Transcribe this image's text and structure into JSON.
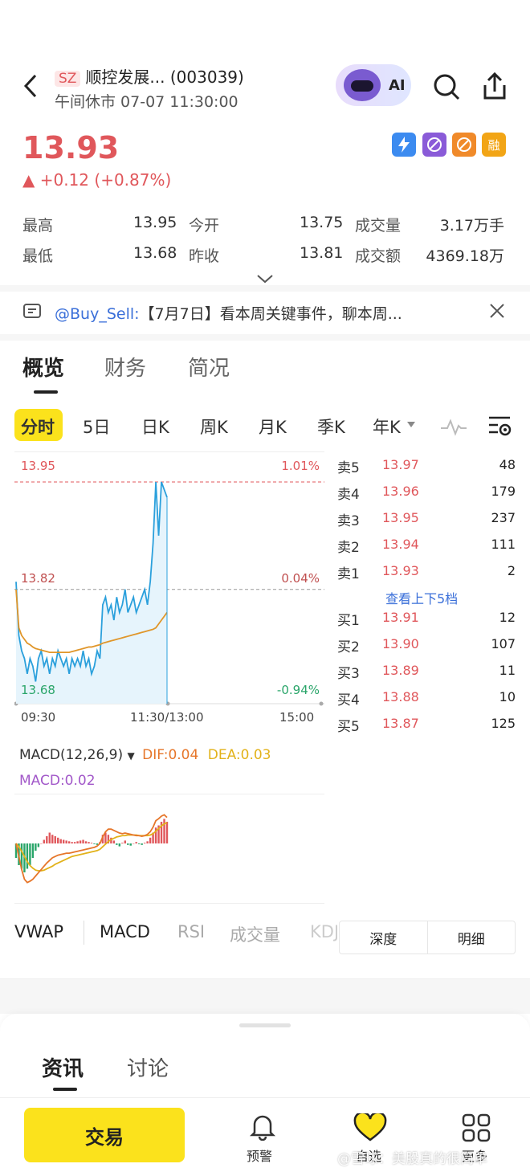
{
  "header": {
    "exchange": "SZ",
    "title": "顺控发展... (003039)",
    "status": "午间休市 07-07 11:30:00",
    "ai_label": "AI"
  },
  "quote": {
    "price": "13.93",
    "change": "▲ +0.12 (+0.87%)",
    "badges": [
      "1",
      "",
      "",
      "融"
    ],
    "stats": [
      {
        "l1": "最高",
        "v1": "13.95",
        "l2": "今开",
        "v2": "13.75",
        "l3": "成交量",
        "v3": "3.17万手"
      },
      {
        "l1": "最低",
        "v1": "13.68",
        "l2": "昨收",
        "v2": "13.81",
        "l3": "成交额",
        "v3": "4369.18万"
      }
    ]
  },
  "notice": {
    "user": "@Buy_Sell:",
    "text": "【7月7日】看本周关键事件，聊本周..."
  },
  "main_tabs": [
    "概览",
    "财务",
    "简况"
  ],
  "period_tabs": [
    "分时",
    "5日",
    "日K",
    "周K",
    "月K",
    "季K",
    "年K"
  ],
  "chart": {
    "price_high": "13.95",
    "price_mid": "13.82",
    "price_low": "13.68",
    "pct_high": "1.01%",
    "pct_mid": "0.04%",
    "pct_low": "-0.94%",
    "time_start": "09:30",
    "time_mid": "11:30/13:00",
    "time_end": "15:00",
    "price_series": [
      13.82,
      13.75,
      13.73,
      13.72,
      13.7,
      13.72,
      13.71,
      13.69,
      13.72,
      13.73,
      13.71,
      13.72,
      13.7,
      13.72,
      13.71,
      13.73,
      13.72,
      13.71,
      13.72,
      13.7,
      13.72,
      13.71,
      13.72,
      13.71,
      13.73,
      13.71,
      13.72,
      13.7,
      13.71,
      13.73,
      13.72,
      13.79,
      13.8,
      13.78,
      13.79,
      13.77,
      13.8,
      13.78,
      13.79,
      13.81,
      13.78,
      13.79,
      13.8,
      13.78,
      13.79,
      13.8,
      13.81,
      13.79,
      13.82,
      13.87,
      13.95,
      13.88,
      13.95,
      13.94,
      13.93
    ],
    "avg_series": [
      13.81,
      13.76,
      13.75,
      13.745,
      13.74,
      13.738,
      13.735,
      13.733,
      13.732,
      13.731,
      13.73,
      13.729,
      13.728,
      13.728,
      13.728,
      13.728,
      13.728,
      13.728,
      13.728,
      13.728,
      13.729,
      13.73,
      13.731,
      13.732,
      13.733,
      13.734,
      13.735,
      13.735,
      13.736,
      13.737,
      13.738,
      13.74,
      13.741,
      13.742,
      13.743,
      13.744,
      13.745,
      13.746,
      13.747,
      13.748,
      13.749,
      13.75,
      13.751,
      13.752,
      13.753,
      13.754,
      13.755,
      13.756,
      13.757,
      13.758,
      13.76,
      13.765,
      13.77,
      13.775,
      13.78
    ]
  },
  "orderbook": {
    "sells": [
      {
        "label": "卖5",
        "price": "13.97",
        "vol": "48"
      },
      {
        "label": "卖4",
        "price": "13.96",
        "vol": "179"
      },
      {
        "label": "卖3",
        "price": "13.95",
        "vol": "237"
      },
      {
        "label": "卖2",
        "price": "13.94",
        "vol": "111"
      },
      {
        "label": "卖1",
        "price": "13.93",
        "vol": "2"
      }
    ],
    "more": "查看上下5档",
    "buys": [
      {
        "label": "买1",
        "price": "13.91",
        "vol": "12"
      },
      {
        "label": "买2",
        "price": "13.90",
        "vol": "107"
      },
      {
        "label": "买3",
        "price": "13.89",
        "vol": "11"
      },
      {
        "label": "买4",
        "price": "13.88",
        "vol": "10"
      },
      {
        "label": "买5",
        "price": "13.87",
        "vol": "125"
      }
    ]
  },
  "macd": {
    "title": "MACD(12,26,9)",
    "dif": "DIF:0.04",
    "dea": "DEA:0.03",
    "macd": "MACD:0.02",
    "bars": [
      -0.02,
      -0.03,
      -0.035,
      -0.04,
      -0.035,
      -0.03,
      -0.02,
      -0.01,
      -0.005,
      0,
      0.005,
      0.01,
      0.015,
      0.012,
      0.01,
      0.008,
      0.006,
      0.005,
      0.004,
      0.003,
      0.002,
      0.002,
      0.003,
      0.004,
      0.005,
      0.003,
      0.002,
      0.001,
      -0.001,
      -0.002,
      0.002,
      0.012,
      0.015,
      0.012,
      0.008,
      0.004,
      -0.002,
      -0.004,
      0.001,
      0.004,
      -0.002,
      -0.003,
      0,
      0.002,
      -0.001,
      -0.002,
      0.001,
      0.003,
      0.008,
      0.015,
      0.022,
      0.025,
      0.03,
      0.034,
      0.03
    ],
    "dif_series": [
      0,
      -0.02,
      -0.04,
      -0.055,
      -0.06,
      -0.058,
      -0.055,
      -0.05,
      -0.045,
      -0.04,
      -0.035,
      -0.03,
      -0.026,
      -0.022,
      -0.02,
      -0.018,
      -0.017,
      -0.016,
      -0.015,
      -0.015,
      -0.014,
      -0.013,
      -0.012,
      -0.011,
      -0.01,
      -0.009,
      -0.008,
      -0.007,
      -0.006,
      -0.004,
      0.0,
      0.01,
      0.018,
      0.022,
      0.022,
      0.02,
      0.018,
      0.016,
      0.015,
      0.016,
      0.015,
      0.014,
      0.013,
      0.012,
      0.012,
      0.011,
      0.012,
      0.014,
      0.018,
      0.025,
      0.035,
      0.038,
      0.042,
      0.044,
      0.04
    ],
    "dea_series": [
      0,
      -0.005,
      -0.012,
      -0.02,
      -0.028,
      -0.034,
      -0.038,
      -0.041,
      -0.042,
      -0.042,
      -0.041,
      -0.039,
      -0.037,
      -0.035,
      -0.032,
      -0.03,
      -0.028,
      -0.026,
      -0.024,
      -0.022,
      -0.02,
      -0.019,
      -0.018,
      -0.017,
      -0.016,
      -0.015,
      -0.014,
      -0.013,
      -0.012,
      -0.011,
      -0.009,
      -0.005,
      -0.001,
      0.003,
      0.006,
      0.008,
      0.01,
      0.011,
      0.012,
      0.012,
      0.013,
      0.013,
      0.013,
      0.013,
      0.012,
      0.012,
      0.012,
      0.012,
      0.013,
      0.015,
      0.019,
      0.023,
      0.027,
      0.03,
      0.032
    ]
  },
  "indicator_tabs": [
    "VWAP",
    "MACD",
    "RSI",
    "成交量",
    "KDJ"
  ],
  "depth_tabs": [
    "深度",
    "明细"
  ],
  "news_tabs": [
    "资讯",
    "讨论"
  ],
  "bottom": {
    "trade": "交易",
    "alert": "预警",
    "watch": "自选",
    "more": "更多",
    "watermark": "@雪球：美股真的很简单"
  },
  "colors": {
    "up": "#e0575b",
    "down": "#2aa56a",
    "accent": "#fbe21c",
    "link": "#3a6fd9"
  }
}
